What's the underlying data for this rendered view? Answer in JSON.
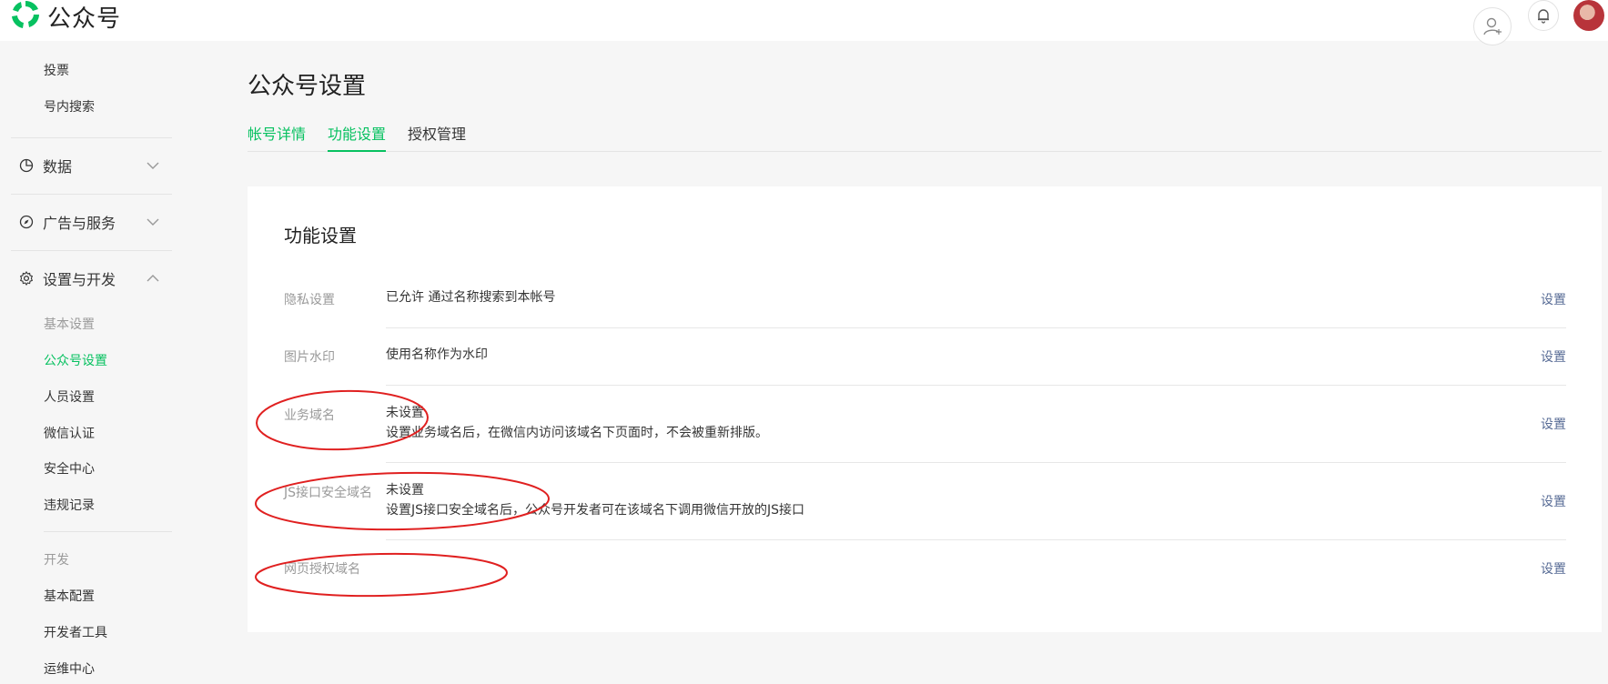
{
  "app": {
    "title": "公众号",
    "brand_color": "#07c160"
  },
  "header": {
    "icons": [
      "wechat-logo-icon",
      "user-switch-icon",
      "bell-icon",
      "avatar"
    ]
  },
  "sidebar": {
    "top_items": [
      {
        "label": "投票"
      },
      {
        "label": "号内搜索"
      }
    ],
    "groups": [
      {
        "label": "数据",
        "icon": "pie-chart-icon",
        "expanded": false
      },
      {
        "label": "广告与服务",
        "icon": "compass-icon",
        "expanded": false
      },
      {
        "label": "设置与开发",
        "icon": "gear-icon",
        "expanded": true
      }
    ],
    "settings_section_label": "基本设置",
    "settings_items": [
      {
        "label": "公众号设置",
        "active": true
      },
      {
        "label": "人员设置"
      },
      {
        "label": "微信认证"
      },
      {
        "label": "安全中心"
      },
      {
        "label": "违规记录"
      }
    ],
    "dev_section_label": "开发",
    "dev_items": [
      {
        "label": "基本配置"
      },
      {
        "label": "开发者工具"
      },
      {
        "label": "运维中心"
      }
    ]
  },
  "main": {
    "page_title": "公众号设置",
    "tabs": [
      {
        "label": "帐号详情"
      },
      {
        "label": "功能设置",
        "active": true
      },
      {
        "label": "授权管理"
      }
    ],
    "card": {
      "title": "功能设置",
      "rows": [
        {
          "label": "隐私设置",
          "value": "已允许 通过名称搜索到本帐号",
          "detail": "",
          "action": "设置"
        },
        {
          "label": "图片水印",
          "value": "使用名称作为水印",
          "detail": "",
          "action": "设置"
        },
        {
          "label": "业务域名",
          "value": "未设置",
          "detail": "设置业务域名后，在微信内访问该域名下页面时，不会被重新排版。",
          "action": "设置"
        },
        {
          "label": "JS接口安全域名",
          "value": "未设置",
          "detail": "设置JS接口安全域名后，公众号开发者可在该域名下调用微信开放的JS接口",
          "action": "设置"
        },
        {
          "label": "网页授权域名",
          "value": "",
          "detail": "",
          "action": "设置"
        }
      ]
    }
  },
  "annotation_color": "#e02020"
}
